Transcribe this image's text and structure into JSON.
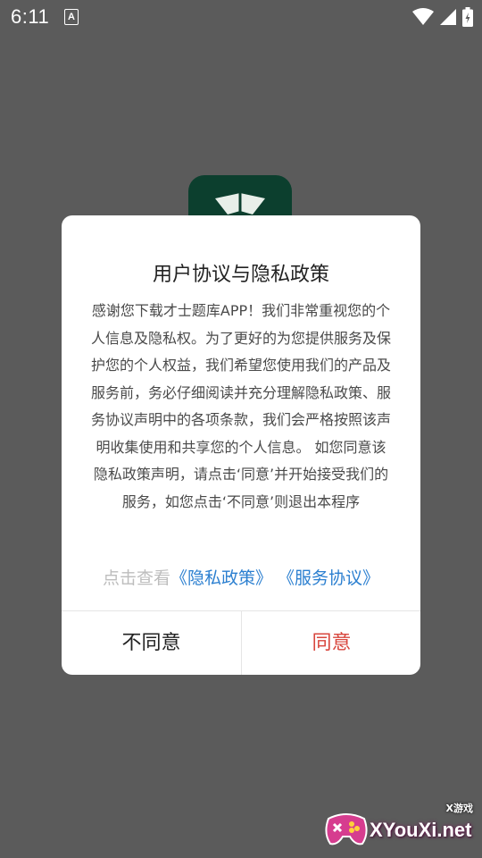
{
  "status_bar": {
    "time": "6:11",
    "notification_icon_letter": "A",
    "icons": [
      "wifi-icon",
      "signal-icon",
      "battery-icon"
    ]
  },
  "background_app": {
    "logo_color": "#0c3f2e"
  },
  "dialog": {
    "title": "用户协议与隐私政策",
    "body": "感谢您下载才士题库APP！我们非常重视您的个人信息及隐私权。为了更好的为您提供服务及保护您的个人权益，我们希望您使用我们的产品及服务前，务必仔细阅读并充分理解隐私政策、服务协议声明中的各项条款，我们会严格按照该声明收集使用和共享您的个人信息。 如您同意该隐私政策声明，请点击‘同意’并开始接受我们的服务，如您点击‘不同意’则退出本程序",
    "links_prefix": "点击查看",
    "privacy_link": "《隐私政策》",
    "service_link": "《服务协议》",
    "disagree_label": "不同意",
    "agree_label": "同意"
  },
  "watermark": {
    "text": "XYouXi.net",
    "sub": "X游戏"
  },
  "colors": {
    "overlay": "#5b5b5b",
    "link": "#2b7fd0",
    "agree": "#d8463d"
  }
}
